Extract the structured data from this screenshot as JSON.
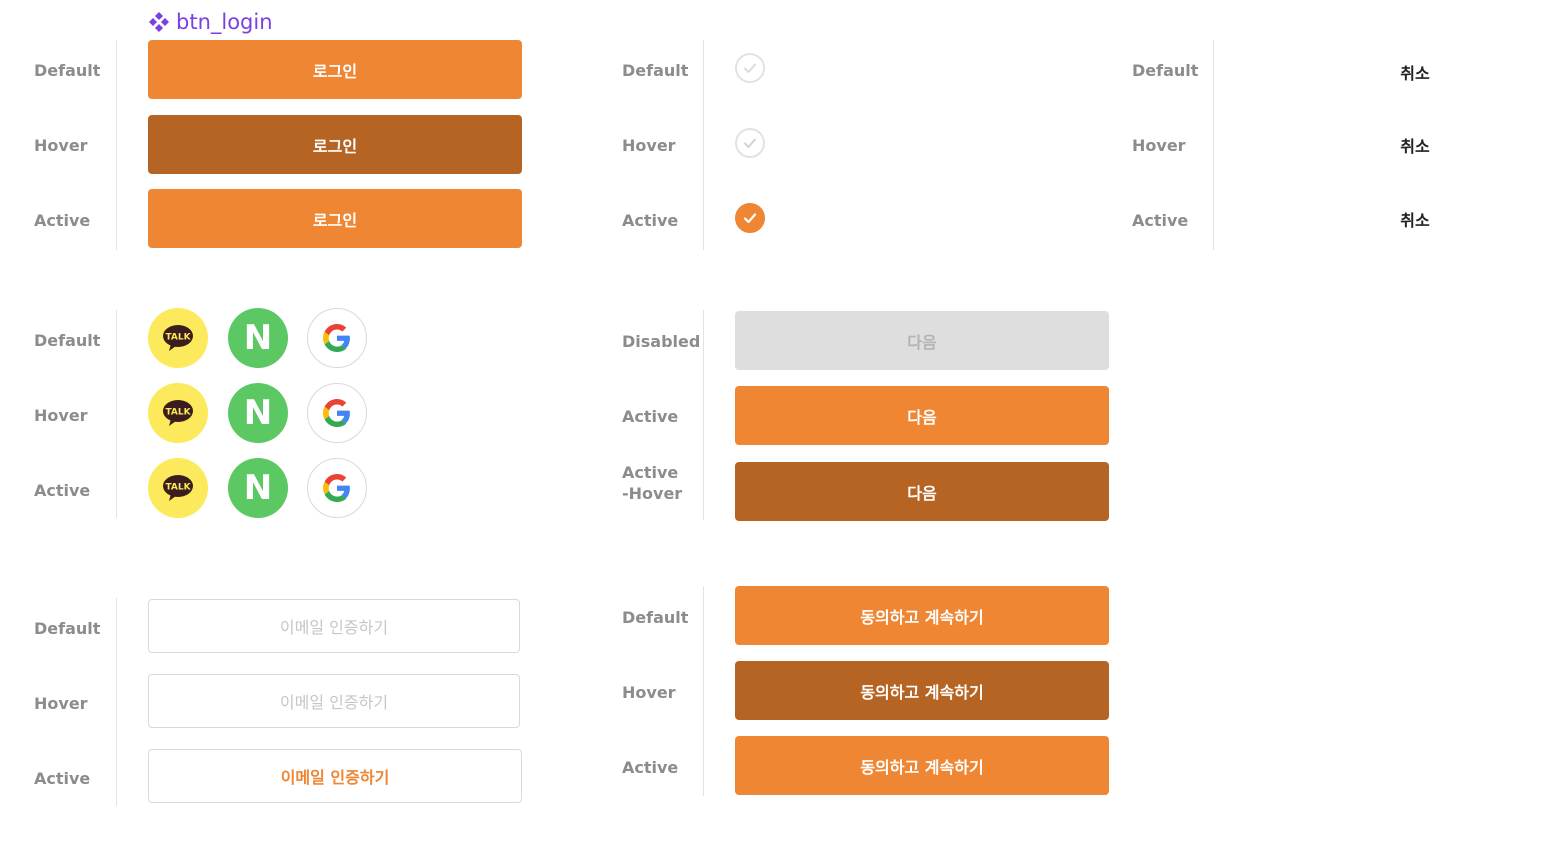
{
  "component": {
    "name": "btn_login",
    "icon": "component-diamond-icon"
  },
  "colors": {
    "accent": "#EE8633",
    "accent_hover": "#B66423",
    "disabled_bg": "#DEDEDE",
    "label_gray": "#8C8C8C",
    "kakao_yellow": "#FCE95C",
    "naver_green": "#5BC864",
    "component_purple": "#7B3FE4"
  },
  "login_buttons": {
    "states": [
      "Default",
      "Hover",
      "Active"
    ],
    "label": "로그인"
  },
  "checkboxes": {
    "states": [
      "Default",
      "Hover",
      "Active"
    ],
    "checked": [
      false,
      false,
      true
    ]
  },
  "cancel_buttons": {
    "states": [
      "Default",
      "Hover",
      "Active"
    ],
    "label": "취소"
  },
  "social_buttons": {
    "states": [
      "Default",
      "Hover",
      "Active"
    ],
    "kakao_label": "TALK",
    "naver_label": "N",
    "google_label": "G",
    "icons": [
      "kakao-talk-icon",
      "naver-icon",
      "google-icon"
    ]
  },
  "next_buttons": {
    "states": [
      "Disabled",
      "Active",
      "Active\n-Hover"
    ],
    "label": "다음"
  },
  "email_buttons": {
    "states": [
      "Default",
      "Hover",
      "Active"
    ],
    "label": "이메일 인증하기"
  },
  "agree_buttons": {
    "states": [
      "Default",
      "Hover",
      "Active"
    ],
    "label": "동의하고 계속하기"
  }
}
